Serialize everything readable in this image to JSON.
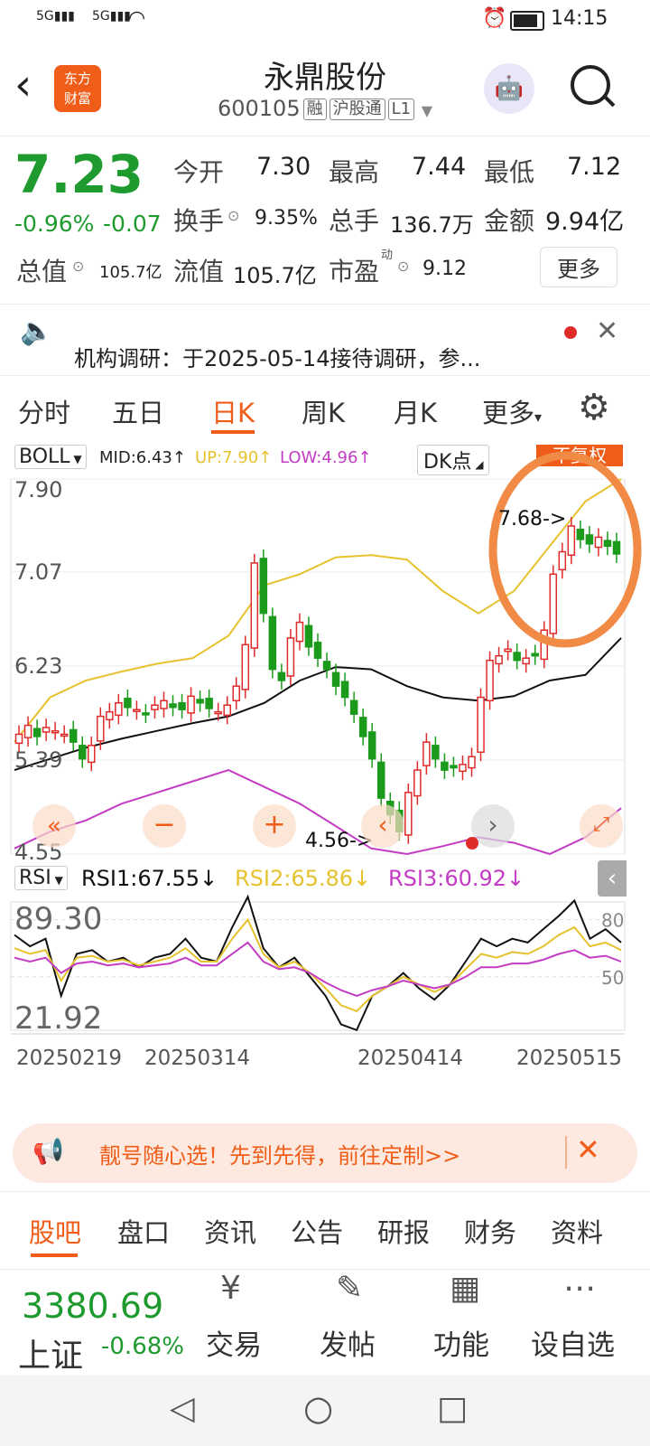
{
  "status": {
    "time": "14:15",
    "signal1": "5G",
    "signal2": "5G"
  },
  "header": {
    "title": "永鼎股份",
    "code": "600105",
    "tags": [
      "融",
      "沪股通",
      "L1"
    ],
    "logo_line1": "东方",
    "logo_line2": "财富"
  },
  "quote": {
    "price": "7.23",
    "change_pct": "-0.96%",
    "change": "-0.07",
    "open_label": "今开",
    "open": "7.30",
    "high_label": "最高",
    "high": "7.44",
    "low_label": "最低",
    "low": "7.12",
    "turnover_label": "换手",
    "turnover": "9.35%",
    "volume_label": "总手",
    "volume": "136.7万",
    "amount_label": "金额",
    "amount": "9.94亿",
    "mktcap_label": "总值",
    "mktcap": "105.7亿",
    "float_label": "流值",
    "float": "105.7亿",
    "pe_label": "市盈",
    "pe_sup": "动",
    "pe": "9.12",
    "more": "更多"
  },
  "notice": {
    "text": "机构调研：于2025-05-14接待调研，参..."
  },
  "tabs": [
    "分时",
    "五日",
    "日K",
    "周K",
    "月K",
    "更多"
  ],
  "indicator": {
    "boll_label": "BOLL",
    "mid": "MID:6.43↑",
    "up": "UP:7.90↑",
    "low": "LOW:4.96↑",
    "dk_label": "DK点",
    "fq_label": "不复权",
    "rsi_label": "RSI",
    "rsi1": "RSI1:67.55↓",
    "rsi2": "RSI2:65.86↓",
    "rsi3": "RSI3:60.92↓"
  },
  "chart_data": {
    "type": "candlestick",
    "y_ticks": [
      "7.90",
      "7.07",
      "6.23",
      "5.39",
      "4.55"
    ],
    "ylim": [
      4.55,
      7.9
    ],
    "annotations": [
      "7.68->",
      "4.56->"
    ],
    "rsi_ticks": [
      "89.30",
      "21.92"
    ],
    "rsi_ref": [
      "80",
      "50"
    ],
    "x_dates": [
      "20250219",
      "20250314",
      "20250414",
      "20250515"
    ],
    "colors": {
      "up": "#e02b2b",
      "down": "#1b9a1b",
      "mid": "#111111",
      "upper": "#e6c22e",
      "lower": "#c33cc3"
    }
  },
  "ad": {
    "text": "靓号随心选！先到先得，前往定制>>"
  },
  "bottom_tabs": [
    "股吧",
    "盘口",
    "资讯",
    "公告",
    "研报",
    "财务",
    "资料"
  ],
  "footer": {
    "index_value": "3380.69",
    "index_name": "上证",
    "index_change": "-0.68%",
    "trade": "交易",
    "post": "发帖",
    "func": "功能",
    "watch": "设自选"
  }
}
